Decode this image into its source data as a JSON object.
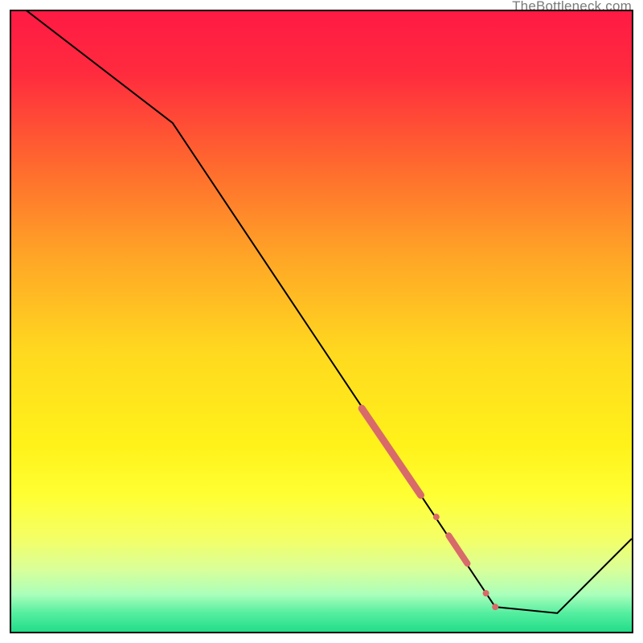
{
  "watermark": "TheBottleneck.com",
  "chart_data": {
    "type": "line",
    "title": "",
    "xlabel": "",
    "ylabel": "",
    "xlim": [
      0,
      100
    ],
    "ylim": [
      0,
      100
    ],
    "background_gradient": {
      "stops": [
        {
          "pos": 0.0,
          "color": "#ff1a44"
        },
        {
          "pos": 0.1,
          "color": "#ff2b3e"
        },
        {
          "pos": 0.25,
          "color": "#ff6a2e"
        },
        {
          "pos": 0.4,
          "color": "#ffa726"
        },
        {
          "pos": 0.55,
          "color": "#ffd91f"
        },
        {
          "pos": 0.7,
          "color": "#fff21a"
        },
        {
          "pos": 0.78,
          "color": "#ffff33"
        },
        {
          "pos": 0.85,
          "color": "#f4ff66"
        },
        {
          "pos": 0.9,
          "color": "#d9ff99"
        },
        {
          "pos": 0.94,
          "color": "#aaffbb"
        },
        {
          "pos": 0.97,
          "color": "#55eea0"
        },
        {
          "pos": 1.0,
          "color": "#22dd88"
        }
      ]
    },
    "series": [
      {
        "name": "bottleneck-curve",
        "x": [
          0,
          26,
          78,
          88,
          100
        ],
        "y": [
          102,
          82,
          4,
          3,
          15
        ],
        "stroke": "#000000",
        "width": 2
      }
    ],
    "markers": [
      {
        "name": "highlight-segment-1",
        "type": "segment",
        "x0": 56.5,
        "y0": 36.0,
        "x1": 66.0,
        "y1": 22.0,
        "color": "#d86a6a",
        "width": 9
      },
      {
        "name": "highlight-dot-1",
        "type": "dot",
        "x": 68.5,
        "y": 18.5,
        "color": "#d86a6a",
        "r": 4
      },
      {
        "name": "highlight-segment-2",
        "type": "segment",
        "x0": 70.5,
        "y0": 15.5,
        "x1": 73.5,
        "y1": 11.0,
        "color": "#d86a6a",
        "width": 8
      },
      {
        "name": "highlight-dot-2",
        "type": "dot",
        "x": 76.5,
        "y": 6.2,
        "color": "#d86a6a",
        "r": 4
      },
      {
        "name": "highlight-dot-3",
        "type": "dot",
        "x": 78.0,
        "y": 4.0,
        "color": "#d86a6a",
        "r": 4
      }
    ]
  }
}
